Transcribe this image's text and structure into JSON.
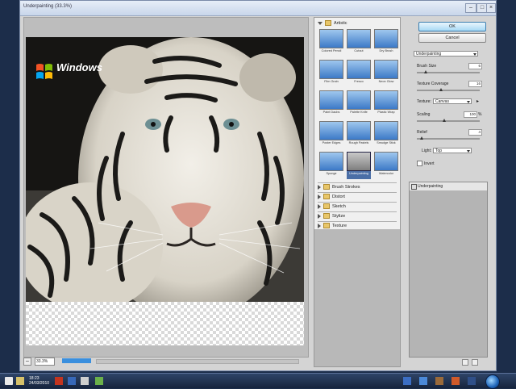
{
  "window": {
    "title": "Underpainting (33.3%)"
  },
  "titlebar_controls": {
    "minimize": "–",
    "maximize": "□",
    "close": "×"
  },
  "preview": {
    "logo_text": "Windows",
    "zoom": "33.3%",
    "zoom_minus": "–",
    "progress": 0.45
  },
  "gallery": {
    "categories": [
      {
        "label": "Artistic",
        "open": true
      },
      {
        "label": "Brush Strokes",
        "open": false
      },
      {
        "label": "Distort",
        "open": false
      },
      {
        "label": "Sketch",
        "open": false
      },
      {
        "label": "Stylize",
        "open": false
      },
      {
        "label": "Texture",
        "open": false
      }
    ],
    "filters": [
      "Colored Pencil",
      "Cutout",
      "Dry Brush",
      "Film Grain",
      "Fresco",
      "Neon Glow",
      "Paint Daubs",
      "Palette Knife",
      "Plastic Wrap",
      "Poster Edges",
      "Rough Pastels",
      "Smudge Stick",
      "Sponge",
      "Underpainting",
      "Watercolor"
    ],
    "selected": "Underpainting"
  },
  "settings": {
    "ok": "OK",
    "cancel": "Cancel",
    "filter_select": "Underpainting",
    "brush_size_label": "Brush Size",
    "brush_size": "6",
    "brush_size_level": 0.15,
    "texture_coverage_label": "Texture Coverage",
    "texture_coverage": "16",
    "texture_coverage_level": 0.4,
    "texture_label": "Texture:",
    "texture": "Canvas",
    "scaling_label": "Scaling",
    "scaling": "100",
    "scaling_unit": "%",
    "scaling_level": 0.45,
    "relief_label": "Relief",
    "relief": "4",
    "relief_level": 0.08,
    "light_label": "Light:",
    "light": "Top",
    "invert_label": "Invert"
  },
  "layers": {
    "item": "Underpainting"
  },
  "taskbar": {
    "time": "18:23",
    "date": "24/03/2010"
  },
  "colors": {
    "selected_filter": "#4a6ea6",
    "ok_button": "#a7d9f5",
    "taskbar": "#1c2d4a"
  }
}
